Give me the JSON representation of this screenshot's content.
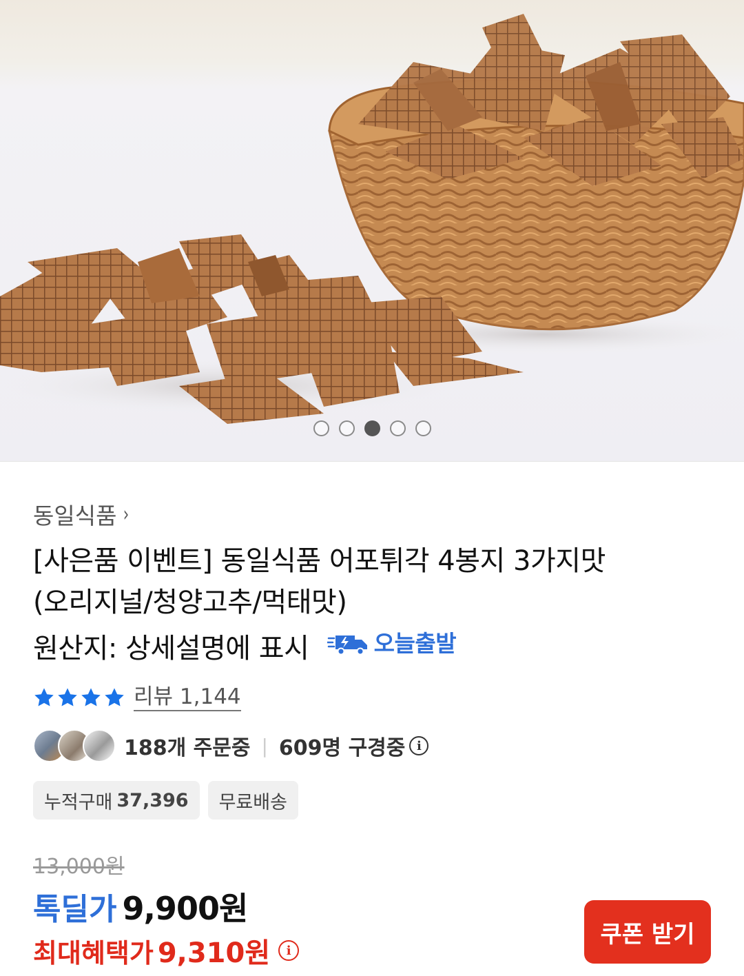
{
  "gallery": {
    "image_alt": "어포튀각 product photo",
    "slide_count": 5,
    "active_index": 2
  },
  "brand": {
    "name": "동일식품",
    "chevron": "›"
  },
  "product": {
    "title_line1": "[사은품 이벤트] 동일식품 어포튀각 4봉지 3가지맛",
    "title_line2": "(오리지널/청양고추/먹태맛)",
    "title_line3": "원산지: 상세설명에 표시",
    "badge_today": "오늘출발"
  },
  "rating": {
    "stars": 4,
    "review_label": "리뷰 1,144"
  },
  "activity": {
    "ordering": "188개 주문중",
    "viewing": "609명 구경중",
    "separator": "|"
  },
  "tags": {
    "cumulative_label": "누적구매",
    "cumulative_value": "37,396",
    "shipping": "무료배송"
  },
  "pricing": {
    "original": "13,000원",
    "deal_label": "톡딜가",
    "deal_price": "9,900원",
    "max_label": "최대혜택가",
    "max_price": "9,310원",
    "info_glyph": "i"
  },
  "actions": {
    "coupon_label": "쿠폰 받기"
  },
  "colors": {
    "accent_blue": "#2e6fd8",
    "accent_red": "#e02a1b",
    "button_red": "#e3301e"
  }
}
